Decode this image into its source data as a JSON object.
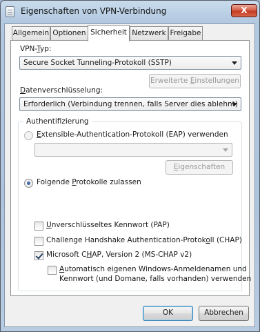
{
  "window": {
    "title": "Eigenschaften von VPN-Verbindung",
    "close_glyph": "X",
    "icon": "vpn-connection-icon"
  },
  "tabs": [
    {
      "label": "Allgemein",
      "active": false
    },
    {
      "label": "Optionen",
      "active": false
    },
    {
      "label": "Sicherheit",
      "active": true
    },
    {
      "label": "Netzwerk",
      "active": false
    },
    {
      "label": "Freigabe",
      "active": false
    }
  ],
  "security": {
    "vpn_type_label_pre": "VPN-",
    "vpn_type_label_u": "T",
    "vpn_type_label_post": "yp:",
    "vpn_type_value": "Secure Socket Tunneling-Protokoll (SSTP)",
    "advanced_pre": "Erweiterte ",
    "advanced_u": "E",
    "advanced_post": "instellungen",
    "encryption_label_pre": "",
    "encryption_label_u": "D",
    "encryption_label_post": "atenverschlüsselung:",
    "encryption_value": "Erforderlich (Verbindung trennen, falls Server dies ablehnt)"
  },
  "auth": {
    "group_title": "Authentifizierung",
    "eap_pre": "",
    "eap_u": "E",
    "eap_post": "xtensible-Authentication-Protokoll (EAP) verwenden",
    "eap_selected": false,
    "eap_combo_value": "",
    "properties_pre": "",
    "properties_u": "E",
    "properties_post": "igenschaften",
    "allow_pre": "Folgende ",
    "allow_u": "P",
    "allow_post": "rotokolle zulassen",
    "allow_selected": true,
    "protocols": [
      {
        "pre": "",
        "u": "U",
        "post": "nverschlüsseltes Kennwort (PAP)",
        "checked": false
      },
      {
        "pre": "Challenge Handshake Authentication-Protok",
        "u": "o",
        "post": "ll (CHAP)",
        "checked": false
      },
      {
        "pre": "Microsoft C",
        "u": "H",
        "post": "AP, Version 2 (MS-CHAP v2)",
        "checked": true
      }
    ],
    "auto_logon_line1_pre": "",
    "auto_logon_line1_u": "A",
    "auto_logon_line1_post": "utomatisch eigenen Windows-Anmeldenamen und",
    "auto_logon_line2": "Kennwort (und Domane, falls vorhanden) verwenden",
    "auto_logon_checked": false
  },
  "footer": {
    "ok": "OK",
    "cancel": "Abbrechen"
  }
}
